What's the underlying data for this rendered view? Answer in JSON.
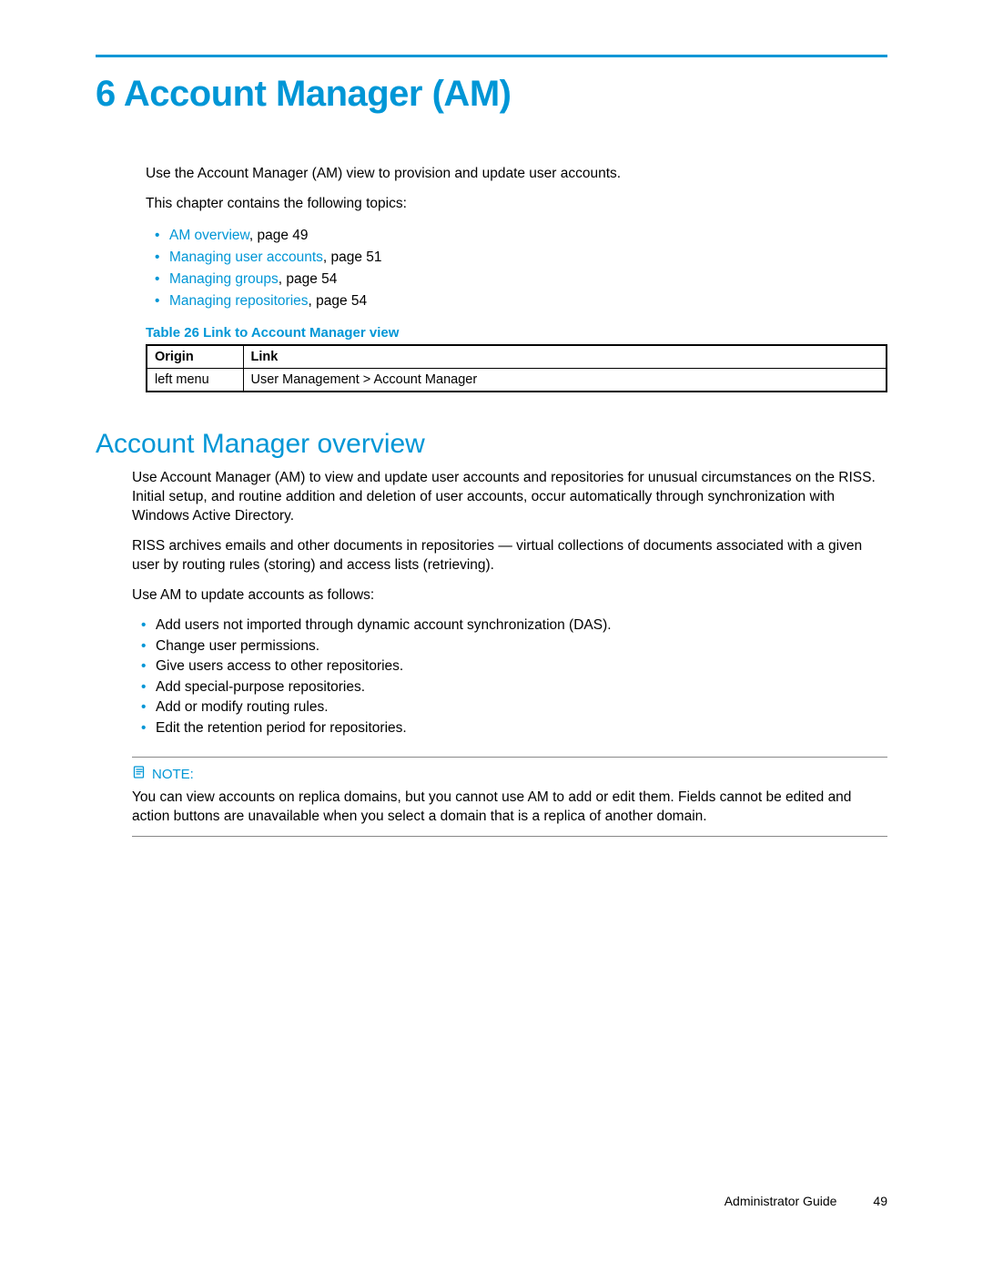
{
  "chapter": {
    "number": "6",
    "title": "Account Manager (AM)"
  },
  "intro": {
    "p1": "Use the Account Manager (AM) view to provision and update user accounts.",
    "p2": "This chapter contains the following topics:"
  },
  "toc": [
    {
      "link": "AM overview",
      "suffix": ", page 49"
    },
    {
      "link": "Managing user accounts",
      "suffix": ", page 51"
    },
    {
      "link": "Managing groups",
      "suffix": ", page 54"
    },
    {
      "link": "Managing repositories",
      "suffix": ", page 54"
    }
  ],
  "table": {
    "caption": "Table 26 Link to Account Manager view",
    "headers": {
      "origin": "Origin",
      "link": "Link"
    },
    "row": {
      "origin": "left menu",
      "link": "User Management > Account Manager"
    }
  },
  "overview": {
    "heading": "Account Manager overview",
    "p1": "Use Account Manager (AM) to view and update user accounts and repositories for unusual circumstances on the RISS. Initial setup, and routine addition and deletion of user accounts, occur automatically through synchronization with Windows Active Directory.",
    "p2": "RISS archives emails and other documents in repositories — virtual collections of documents associated with a given user by routing rules (storing) and access lists (retrieving).",
    "p3": "Use AM to update accounts as follows:",
    "bullets": [
      "Add users not imported through dynamic account synchronization (DAS).",
      "Change user permissions.",
      "Give users access to other repositories.",
      "Add special-purpose repositories.",
      "Add or modify routing rules.",
      "Edit the retention period for repositories."
    ]
  },
  "note": {
    "label": "NOTE:",
    "body": "You can view accounts on replica domains, but you cannot use AM to add or edit them. Fields cannot be edited and action buttons are unavailable when you select a domain that is a replica of another domain."
  },
  "footer": {
    "guide": "Administrator Guide",
    "page": "49"
  }
}
